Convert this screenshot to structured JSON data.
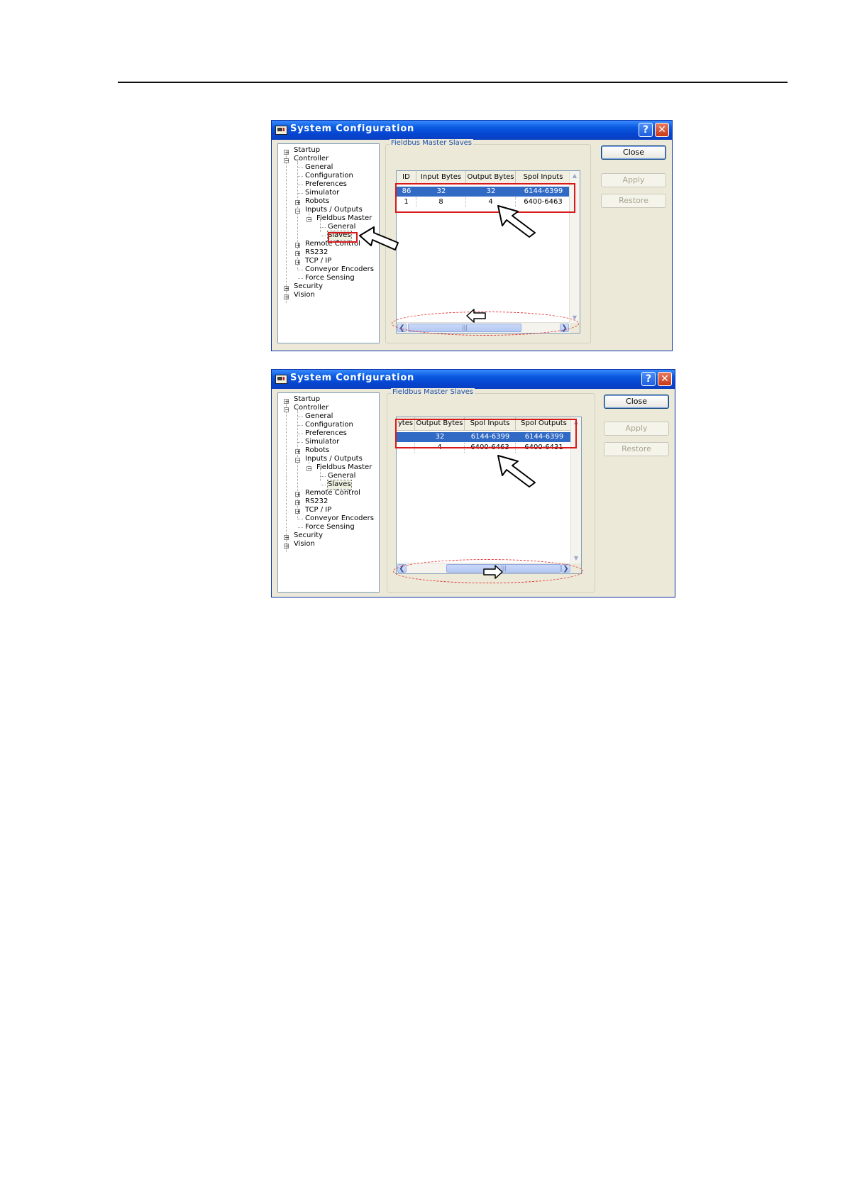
{
  "dialog_title": "System Configuration",
  "help_glyph": "?",
  "close_glyph": "✕",
  "tree": {
    "startup": "Startup",
    "controller": "Controller",
    "general": "General",
    "configuration": "Configuration",
    "preferences": "Preferences",
    "simulator": "Simulator",
    "robots": "Robots",
    "inputs_outputs": "Inputs / Outputs",
    "fieldbus_master": "Fieldbus Master",
    "fb_general": "General",
    "slaves": "Slaves",
    "remote_control": "Remote Control",
    "rs232": "RS232",
    "tcpip": "TCP / IP",
    "conveyor_encoders": "Conveyor Encoders",
    "force_sensing": "Force Sensing",
    "security": "Security",
    "vision": "Vision"
  },
  "group_label": "Fieldbus Master Slaves",
  "buttons": {
    "close": "Close",
    "apply": "Apply",
    "restore": "Restore"
  },
  "screen1": {
    "columns": [
      "ID",
      "Input Bytes",
      "Output Bytes",
      "Spol Inputs"
    ],
    "rows": [
      [
        "86",
        "32",
        "32",
        "6144-6399"
      ],
      [
        "1",
        "8",
        "4",
        "6400-6463"
      ]
    ]
  },
  "screen2": {
    "columns": [
      "ytes",
      "Output Bytes",
      "Spol Inputs",
      "Spol Outputs"
    ],
    "rows": [
      [
        "",
        "32",
        "6144-6399",
        "6144-6399"
      ],
      [
        "",
        "4",
        "6400-6463",
        "6400-6431"
      ]
    ]
  },
  "scroll_grip": "|||",
  "colors": {
    "title_blue": "#0a5ae0",
    "selection": "#316ac5",
    "highlight_red": "#d81919",
    "face": "#ece9d8"
  }
}
